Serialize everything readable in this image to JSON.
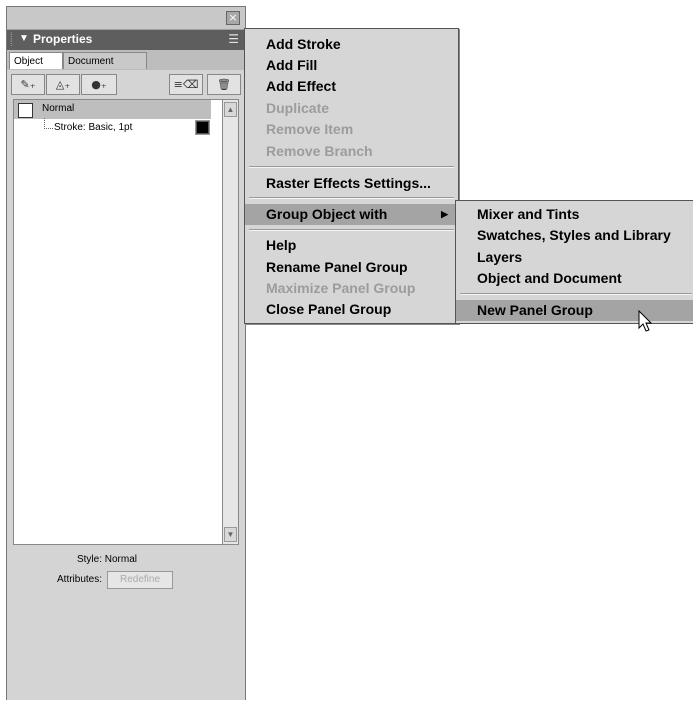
{
  "panel": {
    "close_glyph": "×",
    "title": "Properties",
    "title_arrow": "▼",
    "options_glyph": "☰",
    "tabs": [
      {
        "label": "Object"
      },
      {
        "label": "Document"
      }
    ],
    "toolbar": {
      "stroke_glyph": "✎₊",
      "fill_glyph": "◬₊",
      "effect_glyph": "●₊",
      "delete_all_glyph": "≡⌫",
      "trash_glyph": "🗑"
    },
    "list": {
      "items": [
        {
          "label": "Normal"
        },
        {
          "label": "Stroke: Basic, 1pt"
        }
      ]
    },
    "style_line": "Style: Normal",
    "attributes_label": "Attributes:",
    "redefine_label": "Redefine"
  },
  "menu": {
    "items": [
      {
        "label": "Add Stroke"
      },
      {
        "label": "Add Fill"
      },
      {
        "label": "Add Effect"
      },
      {
        "label": "Duplicate"
      },
      {
        "label": "Remove Item"
      },
      {
        "label": "Remove Branch"
      },
      {
        "label": "Raster Effects Settings..."
      },
      {
        "label": "Group Object with"
      },
      {
        "label": "Help"
      },
      {
        "label": "Rename Panel Group"
      },
      {
        "label": "Maximize Panel Group"
      },
      {
        "label": "Close Panel Group"
      }
    ],
    "submenu_arrow": "▶"
  },
  "submenu": {
    "items": [
      {
        "label": "Mixer and Tints"
      },
      {
        "label": "Swatches, Styles and Library"
      },
      {
        "label": "Layers"
      },
      {
        "label": "Object and Document"
      },
      {
        "label": "New Panel Group"
      }
    ]
  },
  "colors": {
    "panel_bg": "#d4d4d4",
    "titlebar": "#5e5e5e",
    "menu_bg": "#d6d6d6",
    "highlight": "#a4a4a4",
    "disabled_text": "#9c9c9c"
  }
}
